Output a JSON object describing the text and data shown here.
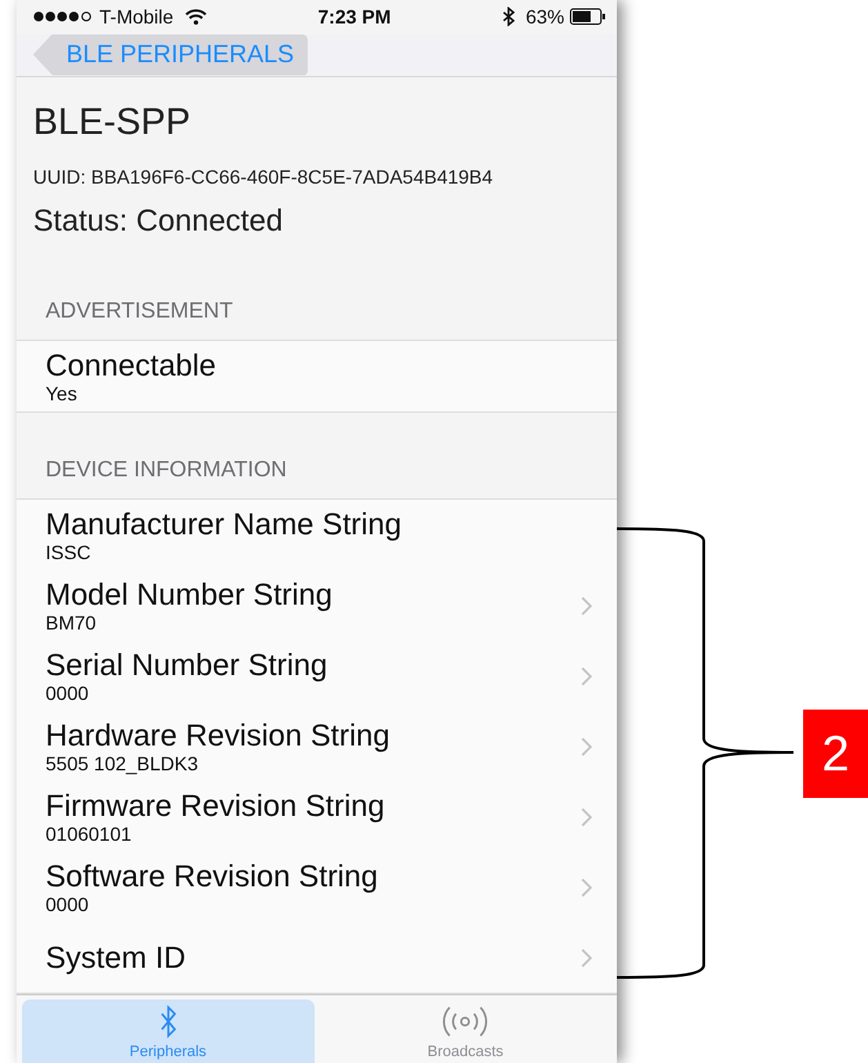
{
  "status_bar": {
    "carrier": "T-Mobile",
    "time": "7:23 PM",
    "battery": "63%"
  },
  "nav": {
    "back_label": "BLE PERIPHERALS"
  },
  "device": {
    "name": "BLE-SPP",
    "uuid": "UUID: BBA196F6-CC66-460F-8C5E-7ADA54B419B4",
    "status": "Status: Connected"
  },
  "sections": [
    {
      "title": "ADVERTISEMENT",
      "rows": [
        {
          "title": "Connectable",
          "value": "Yes",
          "disclosure": false
        }
      ]
    },
    {
      "title": "DEVICE INFORMATION",
      "rows": [
        {
          "title": "Manufacturer Name String",
          "value": "ISSC",
          "disclosure": false
        },
        {
          "title": "Model Number String",
          "value": "BM70",
          "disclosure": true
        },
        {
          "title": "Serial Number String",
          "value": "0000",
          "disclosure": true
        },
        {
          "title": "Hardware Revision String",
          "value": "5505 102_BLDK3",
          "disclosure": true
        },
        {
          "title": "Firmware Revision String",
          "value": "01060101",
          "disclosure": true
        },
        {
          "title": "Software Revision String",
          "value": "0000",
          "disclosure": true
        },
        {
          "title": "System ID",
          "disclosure": true
        }
      ]
    }
  ],
  "tabs": [
    {
      "label": "Peripherals",
      "kind": "bluetooth",
      "selected": true
    },
    {
      "label": "Broadcasts",
      "kind": "broadcast",
      "selected": false
    }
  ],
  "callout": {
    "label": "2"
  }
}
